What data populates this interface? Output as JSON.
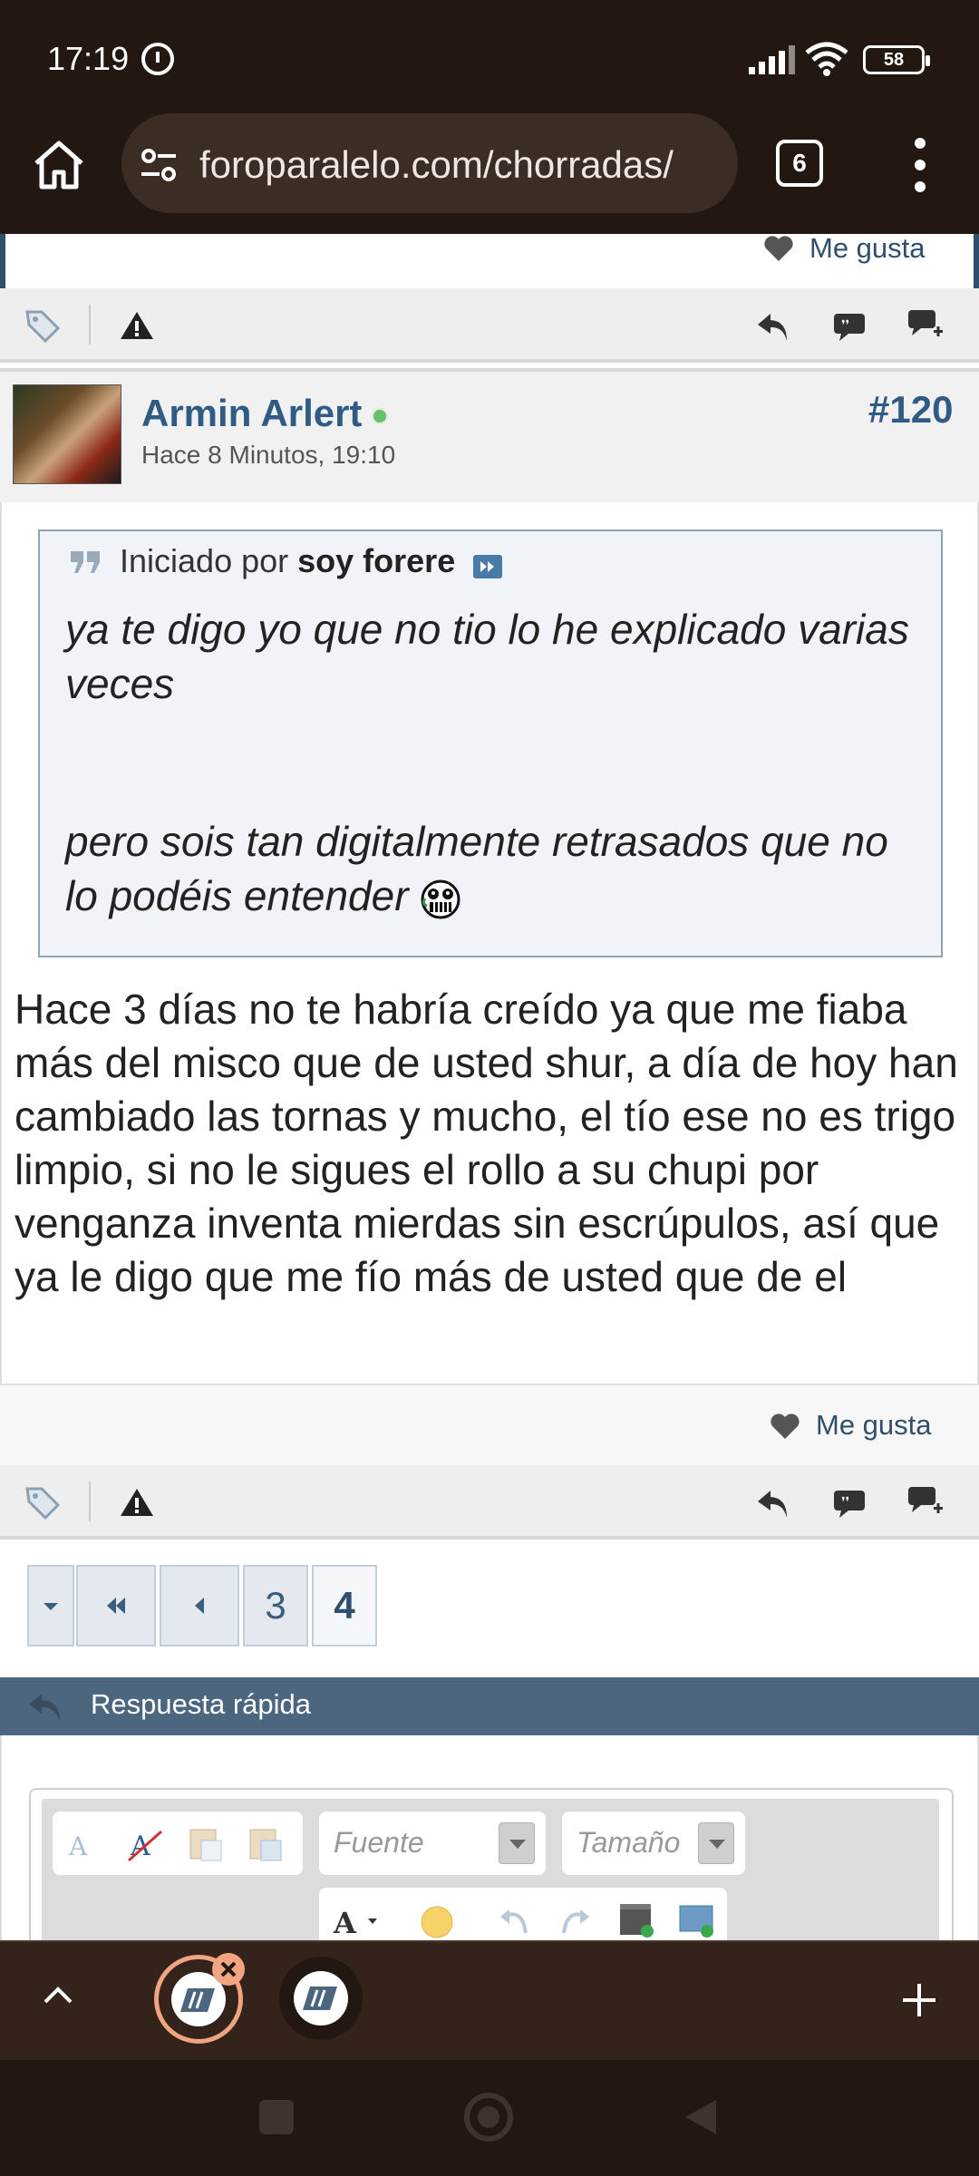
{
  "status_bar": {
    "time": "17:19",
    "battery": "58"
  },
  "browser": {
    "url": "foroparalelo.com/chorradas/",
    "tab_count": "6"
  },
  "top_post": {
    "like_label": "Me gusta"
  },
  "post": {
    "username": "Armin Arlert",
    "date": "Hace 8 Minutos, 19:10",
    "number": "#120",
    "quote": {
      "prefix": "Iniciado por",
      "author": "soy forere",
      "line1": "ya te digo yo que no tio lo he explicado varias veces",
      "line2": "pero sois tan digitalmente retrasados que no lo podéis entender"
    },
    "message": "Hace 3 días no te habría creído ya que me fiaba más del misco que de usted shur, a día de hoy han cambiado las tornas y mucho, el tío ese no es trigo limpio, si no le sigues el rollo a su chupi por venganza inventa mierdas sin escrúpulos, así que ya le digo que me fío más de usted que de el",
    "like_label": "Me gusta"
  },
  "pagination": {
    "pages": [
      "3",
      "4"
    ],
    "current": "4"
  },
  "quick_reply": {
    "title": "Respuesta rápida",
    "font_placeholder": "Fuente",
    "size_placeholder": "Tamaño"
  },
  "colors": {
    "accent": "#2f5b84",
    "browser_bg": "#221711",
    "quick_reply_bar": "#4d6680"
  }
}
